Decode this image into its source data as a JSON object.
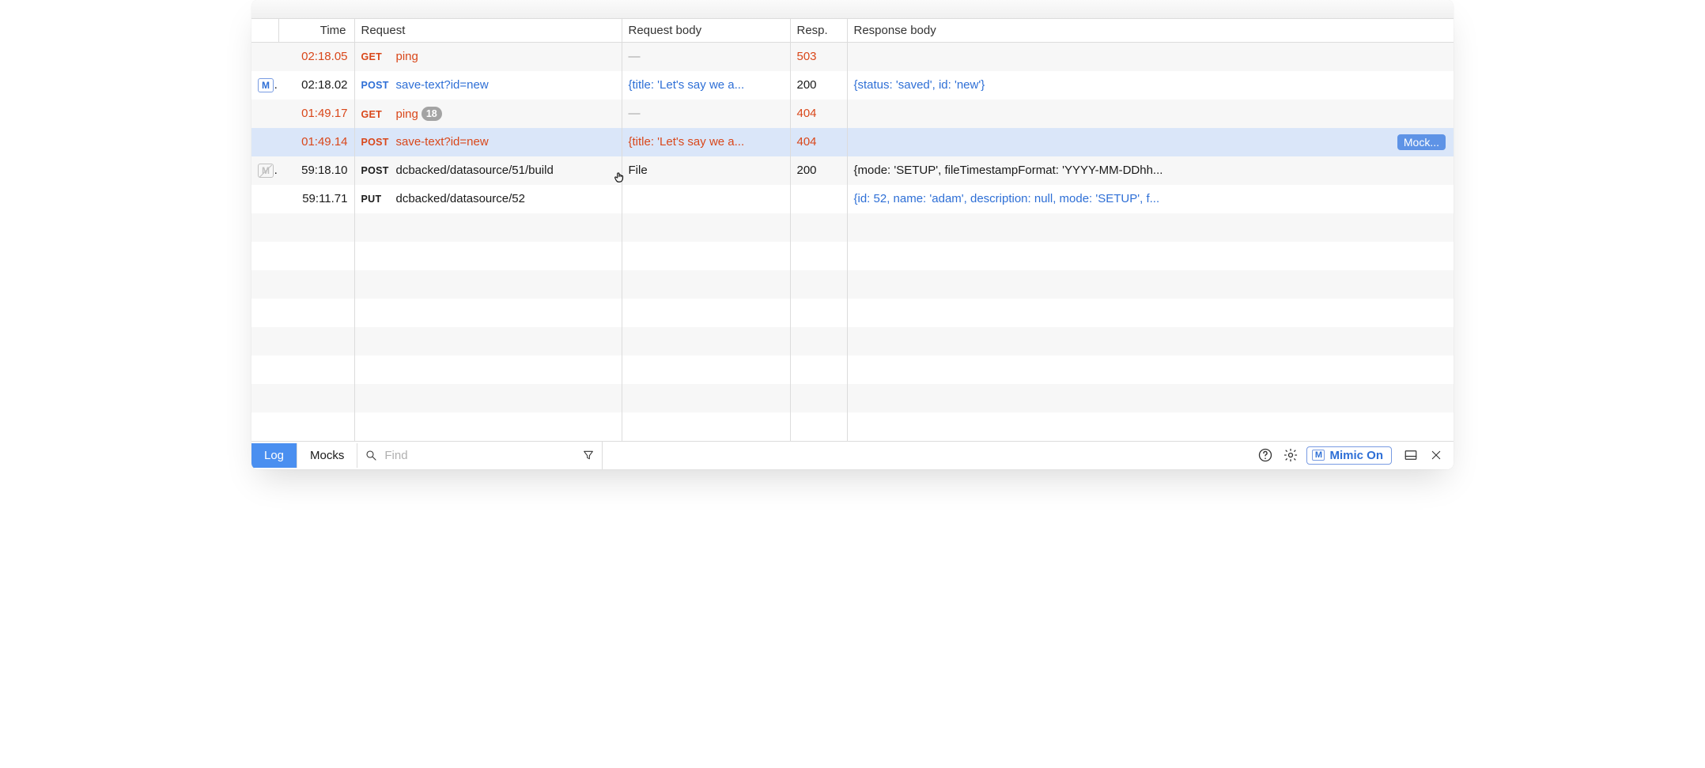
{
  "columns": {
    "time": "Time",
    "request": "Request",
    "request_body": "Request body",
    "resp": "Resp.",
    "response_body": "Response body"
  },
  "rows": [
    {
      "mock": null,
      "time": "02:18.05",
      "method": "GET",
      "path": "ping",
      "badge": null,
      "request_body": "—",
      "resp": "503",
      "response_body": "",
      "tone_time": "orange",
      "tone_req": "orange",
      "tone_body": "gray",
      "tone_resp": "orange",
      "tone_resb": "black"
    },
    {
      "mock": "on",
      "time": "02:18.02",
      "method": "POST",
      "path": "save-text?id=new",
      "badge": null,
      "request_body": "{title: 'Let's say we a...",
      "resp": "200",
      "response_body": "{status: 'saved', id: 'new'}",
      "tone_time": "black",
      "tone_req": "blue",
      "tone_body": "blue",
      "tone_resp": "black",
      "tone_resb": "blue"
    },
    {
      "mock": null,
      "time": "01:49.17",
      "method": "GET",
      "path": "ping",
      "badge": "18",
      "request_body": "—",
      "resp": "404",
      "response_body": "",
      "tone_time": "orange",
      "tone_req": "orange",
      "tone_body": "gray",
      "tone_resp": "orange",
      "tone_resb": "black"
    },
    {
      "mock": null,
      "time": "01:49.14",
      "method": "POST",
      "path": "save-text?id=new",
      "badge": null,
      "request_body": "{title: 'Let's say we a...",
      "resp": "404",
      "response_body": "",
      "tone_time": "orange",
      "tone_req": "orange",
      "tone_body": "orange",
      "tone_resp": "orange",
      "tone_resb": "black",
      "selected": true,
      "mock_button": "Mock..."
    },
    {
      "mock": "off",
      "time": "59:18.10",
      "method": "POST",
      "path": "dcbacked/datasource/51/build",
      "badge": null,
      "request_body": "File",
      "resp": "200",
      "response_body": "{mode: 'SETUP', fileTimestampFormat: 'YYYY-MM-DDhh...",
      "tone_time": "black",
      "tone_req": "black",
      "tone_body": "black",
      "tone_resp": "black",
      "tone_resb": "black"
    },
    {
      "mock": null,
      "time": "59:11.71",
      "method": "PUT",
      "path": "dcbacked/datasource/52",
      "badge": null,
      "request_body": "",
      "resp": "",
      "response_body": "{id: 52, name: 'adam', description: null, mode: 'SETUP', f...",
      "tone_time": "black",
      "tone_req": "black",
      "tone_body": "black",
      "tone_resp": "black",
      "tone_resb": "blue"
    }
  ],
  "empty_rows": 8,
  "bottom": {
    "tab_log": "Log",
    "tab_mocks": "Mocks",
    "find_placeholder": "Find",
    "mimic_label": "Mimic On",
    "mimic_badge": "M"
  },
  "mock_badge_letter": "M"
}
